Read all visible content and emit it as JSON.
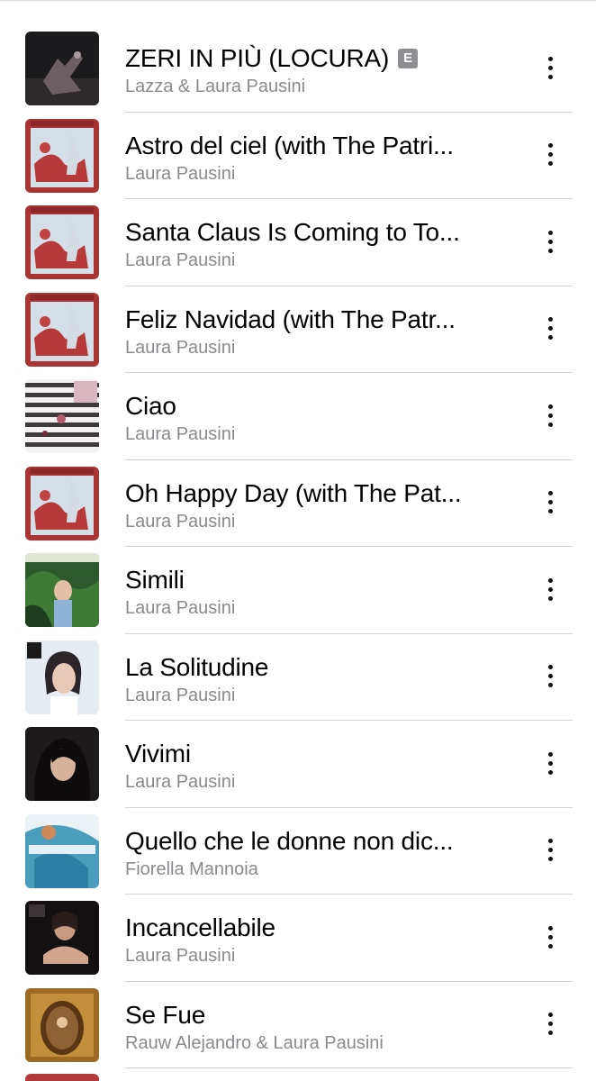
{
  "songs": [
    {
      "title": "ZERI IN PIÙ (LOCURA)",
      "artist": "Lazza & Laura Pausini",
      "explicit": true,
      "explicit_label": "E",
      "art": "dark"
    },
    {
      "title": "Astro del ciel (with The Patri...",
      "artist": "Laura Pausini",
      "explicit": false,
      "art": "christmas"
    },
    {
      "title": "Santa Claus Is Coming to To...",
      "artist": "Laura Pausini",
      "explicit": false,
      "art": "christmas"
    },
    {
      "title": "Feliz Navidad (with The Patr...",
      "artist": "Laura Pausini",
      "explicit": false,
      "art": "christmas"
    },
    {
      "title": "Ciao",
      "artist": "Laura Pausini",
      "explicit": false,
      "art": "stripes"
    },
    {
      "title": "Oh Happy Day (with The Pat...",
      "artist": "Laura Pausini",
      "explicit": false,
      "art": "christmas"
    },
    {
      "title": "Simili",
      "artist": "Laura Pausini",
      "explicit": false,
      "art": "green"
    },
    {
      "title": "La Solitudine",
      "artist": "Laura Pausini",
      "explicit": false,
      "art": "portrait-light"
    },
    {
      "title": "Vivimi",
      "artist": "Laura Pausini",
      "explicit": false,
      "art": "portrait-dark"
    },
    {
      "title": "Quello che le donne non dic...",
      "artist": "Fiorella Mannoia",
      "explicit": false,
      "art": "fiorella"
    },
    {
      "title": "Incancellabile",
      "artist": "Laura Pausini",
      "explicit": false,
      "art": "best"
    },
    {
      "title": "Se Fue",
      "artist": "Rauw Alejandro & Laura Pausini",
      "explicit": false,
      "art": "gold"
    }
  ],
  "icons": {
    "more": "more-vertical-icon",
    "explicit": "explicit-badge"
  },
  "colors": {
    "title_text": "#000000",
    "artist_text": "#8a8a8e",
    "divider": "#d4d4d6",
    "explicit_badge": "#8e8e93"
  }
}
